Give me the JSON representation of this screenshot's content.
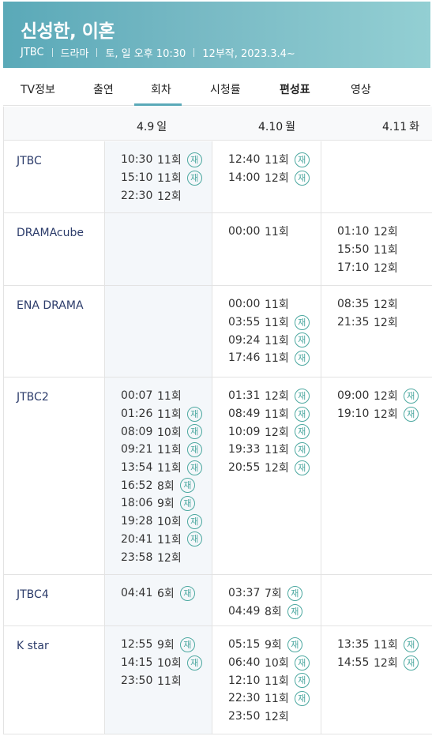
{
  "program": {
    "title": "신성한, 이혼",
    "meta": [
      "JTBC",
      "드라마",
      "토, 일 오후 10:30",
      "12부작, 2023.3.4~"
    ]
  },
  "tabs": [
    "TV정보",
    "출연",
    "회차",
    "시청률",
    "편성표",
    "영상"
  ],
  "days": [
    {
      "date": "4.9",
      "dow": "일"
    },
    {
      "date": "4.10",
      "dow": "월"
    },
    {
      "date": "4.11",
      "dow": "화"
    }
  ],
  "rerun_mark": "재",
  "channels": [
    {
      "name": "JTBC",
      "days": [
        [
          {
            "time": "10:30",
            "ep": "11회",
            "re": true
          },
          {
            "time": "15:10",
            "ep": "11회",
            "re": true
          },
          {
            "time": "22:30",
            "ep": "12회",
            "re": false
          }
        ],
        [
          {
            "time": "12:40",
            "ep": "11회",
            "re": true
          },
          {
            "time": "14:00",
            "ep": "12회",
            "re": true
          }
        ],
        []
      ]
    },
    {
      "name": "DRAMAcube",
      "days": [
        [],
        [
          {
            "time": "00:00",
            "ep": "11회",
            "re": false
          }
        ],
        [
          {
            "time": "01:10",
            "ep": "12회",
            "re": false
          },
          {
            "time": "15:50",
            "ep": "11회",
            "re": false
          },
          {
            "time": "17:10",
            "ep": "12회",
            "re": false
          }
        ]
      ]
    },
    {
      "name": "ENA DRAMA",
      "days": [
        [],
        [
          {
            "time": "00:00",
            "ep": "11회",
            "re": false
          },
          {
            "time": "03:55",
            "ep": "11회",
            "re": true
          },
          {
            "time": "09:24",
            "ep": "11회",
            "re": true
          },
          {
            "time": "17:46",
            "ep": "11회",
            "re": true
          }
        ],
        [
          {
            "time": "08:35",
            "ep": "12회",
            "re": false
          },
          {
            "time": "21:35",
            "ep": "12회",
            "re": false
          }
        ]
      ]
    },
    {
      "name": "JTBC2",
      "days": [
        [
          {
            "time": "00:07",
            "ep": "11회",
            "re": false
          },
          {
            "time": "01:26",
            "ep": "11회",
            "re": true
          },
          {
            "time": "08:09",
            "ep": "10회",
            "re": true
          },
          {
            "time": "09:21",
            "ep": "11회",
            "re": true
          },
          {
            "time": "13:54",
            "ep": "11회",
            "re": true
          },
          {
            "time": "16:52",
            "ep": "8회",
            "re": true
          },
          {
            "time": "18:06",
            "ep": "9회",
            "re": true
          },
          {
            "time": "19:28",
            "ep": "10회",
            "re": true
          },
          {
            "time": "20:41",
            "ep": "11회",
            "re": true
          },
          {
            "time": "23:58",
            "ep": "12회",
            "re": false
          }
        ],
        [
          {
            "time": "01:31",
            "ep": "12회",
            "re": true
          },
          {
            "time": "08:49",
            "ep": "11회",
            "re": true
          },
          {
            "time": "10:09",
            "ep": "12회",
            "re": true
          },
          {
            "time": "19:33",
            "ep": "11회",
            "re": true
          },
          {
            "time": "20:55",
            "ep": "12회",
            "re": true
          }
        ],
        [
          {
            "time": "09:00",
            "ep": "12회",
            "re": true
          },
          {
            "time": "19:10",
            "ep": "12회",
            "re": true
          }
        ]
      ]
    },
    {
      "name": "JTBC4",
      "days": [
        [
          {
            "time": "04:41",
            "ep": "6회",
            "re": true
          }
        ],
        [
          {
            "time": "03:37",
            "ep": "7회",
            "re": true
          },
          {
            "time": "04:49",
            "ep": "8회",
            "re": true
          }
        ],
        []
      ]
    },
    {
      "name": "K star",
      "days": [
        [
          {
            "time": "12:55",
            "ep": "9회",
            "re": true
          },
          {
            "time": "14:15",
            "ep": "10회",
            "re": true
          },
          {
            "time": "23:50",
            "ep": "11회",
            "re": false
          }
        ],
        [
          {
            "time": "05:15",
            "ep": "9회",
            "re": true
          },
          {
            "time": "06:40",
            "ep": "10회",
            "re": true
          },
          {
            "time": "12:10",
            "ep": "11회",
            "re": true
          },
          {
            "time": "22:30",
            "ep": "11회",
            "re": true
          },
          {
            "time": "23:50",
            "ep": "12회",
            "re": false
          }
        ],
        [
          {
            "time": "13:35",
            "ep": "11회",
            "re": true
          },
          {
            "time": "14:55",
            "ep": "12회",
            "re": true
          }
        ]
      ]
    }
  ]
}
